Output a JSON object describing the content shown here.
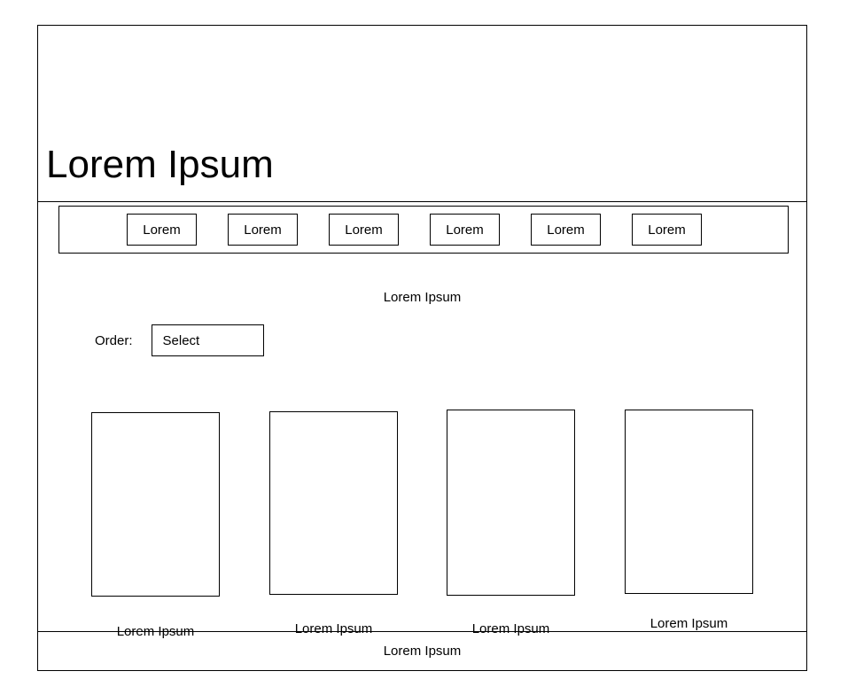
{
  "frame": {
    "background_color": "#ffffff",
    "border_color": "#000000"
  },
  "header": {
    "title": "Lorem Ipsum"
  },
  "navbar": {
    "items": [
      {
        "label": "Lorem"
      },
      {
        "label": "Lorem"
      },
      {
        "label": "Lorem"
      },
      {
        "label": "Lorem"
      },
      {
        "label": "Lorem"
      },
      {
        "label": "Lorem"
      }
    ]
  },
  "main": {
    "heading": "Lorem Ipsum",
    "order": {
      "label": "Order:",
      "select_value": "Select"
    },
    "cards": [
      {
        "caption": "Lorem Ipsum"
      },
      {
        "caption": "Lorem Ipsum"
      },
      {
        "caption": "Lorem Ipsum"
      },
      {
        "caption": "Lorem Ipsum"
      }
    ]
  },
  "footer": {
    "text": "Lorem Ipsum"
  }
}
